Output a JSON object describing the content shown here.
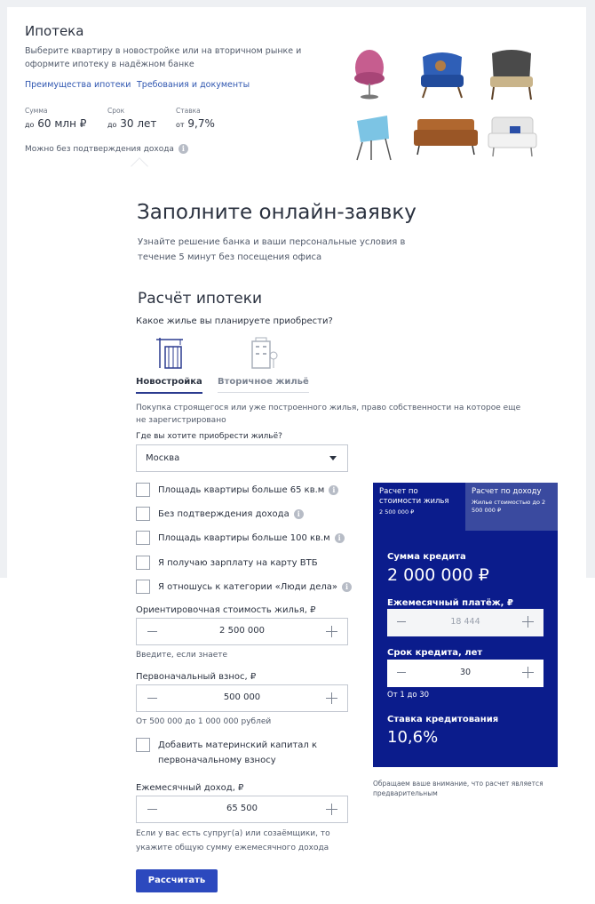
{
  "hero": {
    "title": "Ипотека",
    "description": "Выберите квартиру в новостройке или на вторичном рынке и оформите ипотеку в надёжном банке",
    "link_advantages": "Преимущества ипотеки",
    "link_requirements": "Требования и документы",
    "stats": [
      {
        "label": "Сумма",
        "prefix": "до",
        "value": "60 млн ₽"
      },
      {
        "label": "Срок",
        "prefix": "до",
        "value": "30 лет"
      },
      {
        "label": "Ставка",
        "prefix": "от",
        "value": "9,7%"
      }
    ],
    "note": "Можно без подтверждения дохода"
  },
  "form": {
    "title": "Заполните онлайн-заявку",
    "subtitle": "Узнайте решение банка и ваши персональные условия в течение 5 минут без посещения офиса",
    "calc_title": "Расчёт ипотеки",
    "question": "Какое жилье вы планируете приобрести?",
    "property_types": [
      "Новостройка",
      "Вторичное жильё"
    ],
    "type_description": "Покупка строящегося или уже построенного жилья, право собственности на которое еще не зарегистрировано",
    "city_label": "Где вы хотите приобрести жильё?",
    "city_value": "Москва",
    "checkboxes": [
      "Площадь квартиры больше 65 кв.м",
      "Без подтверждения дохода",
      "Площадь квартиры больше 100 кв.м",
      "Я получаю зарплату на карту ВТБ",
      "Я отношусь к категории «Люди дела»"
    ],
    "price_label": "Ориентировочная стоимость жилья, ₽",
    "price_value": "2 500 000",
    "price_hint": "Введите, если знаете",
    "down_label": "Первоначальный взнос, ₽",
    "down_value": "500 000",
    "down_hint": "От 500 000 до 1 000 000 рублей",
    "matcap_label": "Добавить материнский капитал к первоначальному взносу",
    "income_label": "Ежемесячный доход, ₽",
    "income_value": "65 500",
    "income_hint": "Если у вас есть супруг(а) или созаёмщики, то укажите общую сумму ежемесячного дохода",
    "submit": "Рассчитать"
  },
  "panel": {
    "tab1_title": "Расчет по стоимости жилья",
    "tab1_sub": "2 500 000 ₽",
    "tab2_title": "Расчет по доходу",
    "tab2_sub": "Жилье стоимостью до 2 500 000 ₽",
    "loan_label": "Сумма кредита",
    "loan_value": "2 000 000 ₽",
    "payment_label": "Ежемесячный платёж, ₽",
    "payment_value": "18 444",
    "term_label": "Срок кредита, лет",
    "term_value": "30",
    "term_hint": "От 1 до 30",
    "rate_label": "Ставка кредитования",
    "rate_value": "10,6%",
    "note": "Обращаем ваше внимание, что расчет является предварительным"
  },
  "colors": {
    "panel": "#0b1c8c",
    "button": "#2c49be",
    "link": "#2f56b0"
  }
}
